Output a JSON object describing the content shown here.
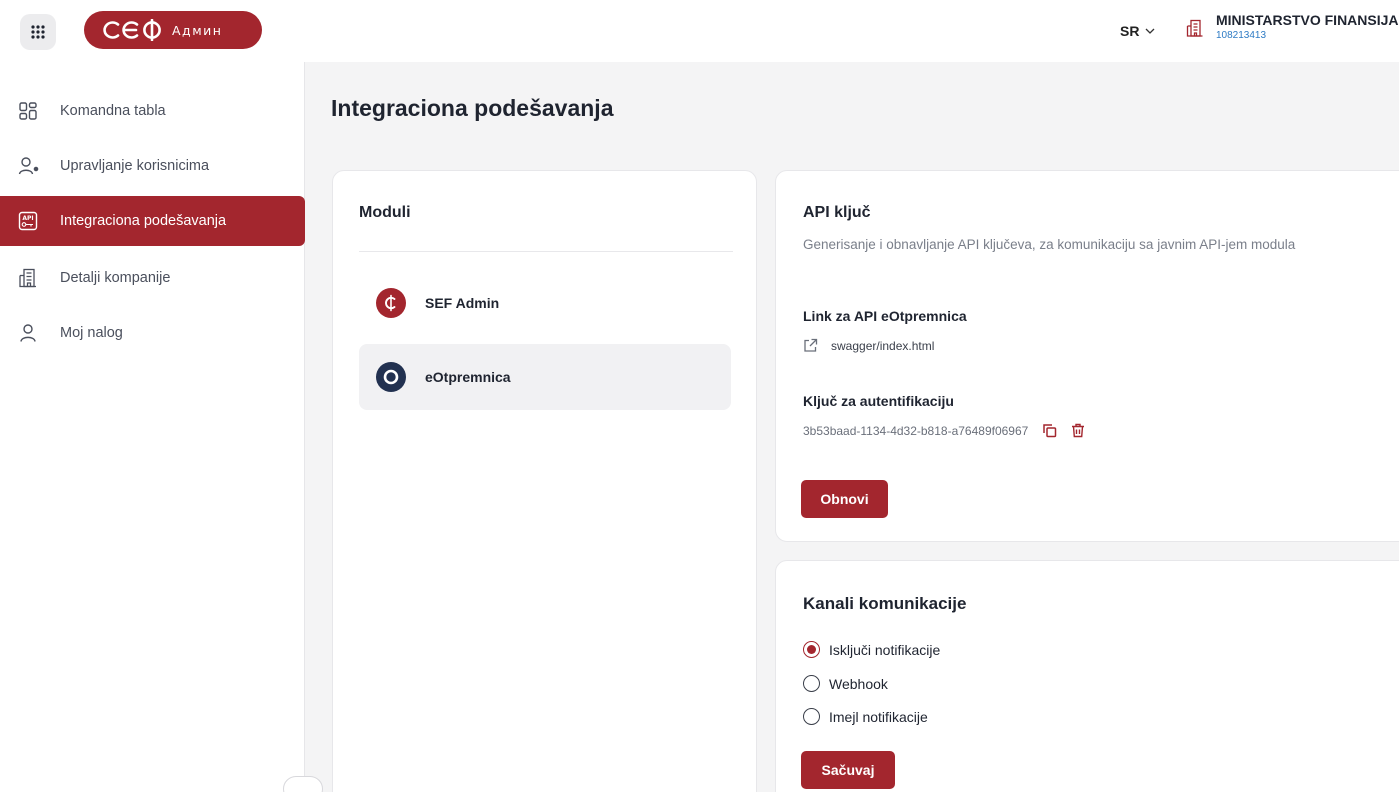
{
  "header": {
    "logo_text": "Админ",
    "language": "SR",
    "company_name": "MINISTARSTVO FINANSIJA",
    "company_id": "108213413"
  },
  "sidebar": {
    "items": [
      {
        "label": "Komandna tabla",
        "icon": "dashboard-icon",
        "active": false
      },
      {
        "label": "Upravljanje korisnicima",
        "icon": "users-icon",
        "active": false
      },
      {
        "label": "Integraciona podešavanja",
        "icon": "api-key-icon",
        "active": true
      },
      {
        "label": "Detalji kompanije",
        "icon": "building-icon",
        "active": false
      },
      {
        "label": "Moj nalog",
        "icon": "user-icon",
        "active": false
      }
    ]
  },
  "main": {
    "title": "Integraciona podešavanja",
    "modules": {
      "title": "Moduli",
      "items": [
        {
          "name": "SEF Admin",
          "icon": "sef-logo-icon",
          "selected": false
        },
        {
          "name": "eOtpremnica",
          "icon": "eotpremnica-logo-icon",
          "selected": true
        }
      ]
    },
    "api": {
      "title": "API ključ",
      "description": "Generisanje i obnavljanje API ključeva, za komunikaciju sa javnim API-jem modula",
      "link_label": "Link za API eOtpremnica",
      "link_text": "swagger/index.html",
      "key_label": "Ključ za autentifikaciju",
      "key_value": "3b53baad-1134-4d32-b818-a76489f06967",
      "renew_button": "Obnovi"
    },
    "channels": {
      "title": "Kanali komunikacije",
      "options": [
        {
          "label": "Isključi notifikacije",
          "checked": true
        },
        {
          "label": "Webhook",
          "checked": false
        },
        {
          "label": "Imejl notifikacije",
          "checked": false
        }
      ],
      "save_button": "Sačuvaj"
    }
  },
  "colors": {
    "brand": "#a3262e",
    "link_blue": "#2e7bc4",
    "module_dark": "#223150"
  }
}
